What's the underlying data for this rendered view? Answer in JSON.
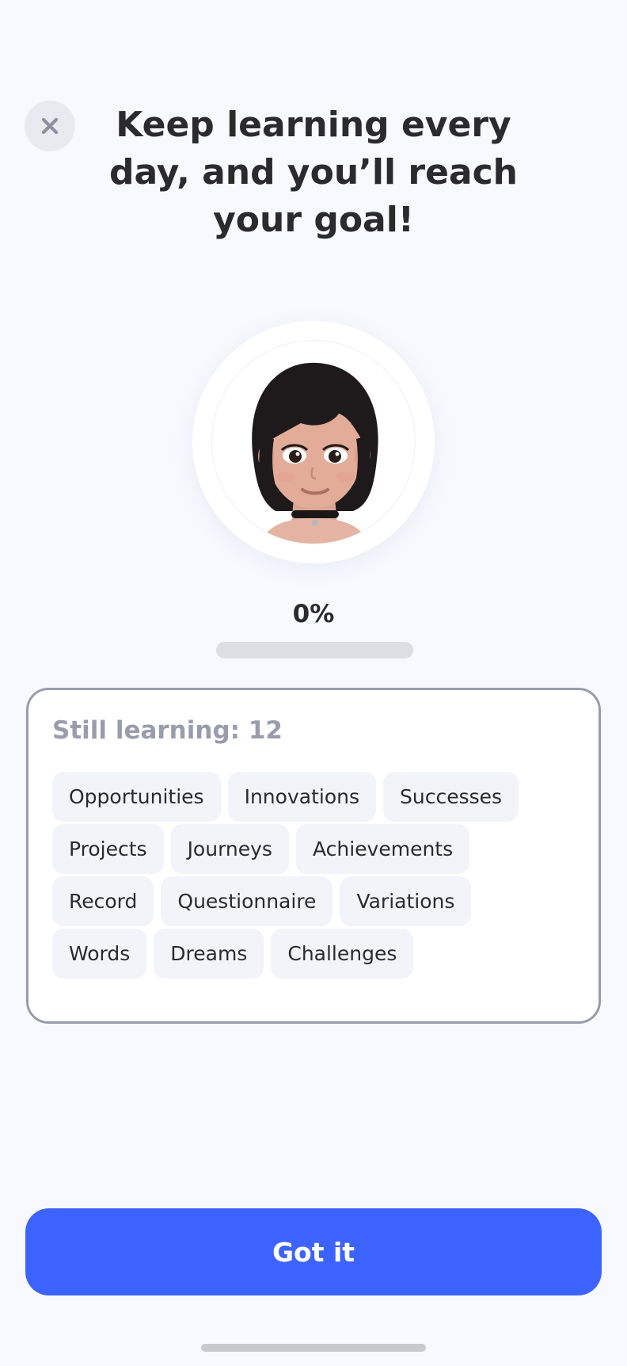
{
  "header": {
    "close_icon": "close-icon",
    "title": "Keep learning every day, and you’ll reach your goal!"
  },
  "progress": {
    "percent_label": "0%",
    "fraction": 0
  },
  "still_learning": {
    "title": "Still learning: 12",
    "words": [
      "Opportunities",
      "Innovations",
      "Successes",
      "Projects",
      "Journeys",
      "Achievements",
      "Record",
      "Questionnaire",
      "Variations",
      "Words",
      "Dreams",
      "Challenges"
    ]
  },
  "cta": {
    "label": "Got it"
  },
  "colors": {
    "accent": "#3d63ff",
    "text": "#2b2b2e",
    "muted": "#9a9cad",
    "background": "#f8f9fe"
  }
}
